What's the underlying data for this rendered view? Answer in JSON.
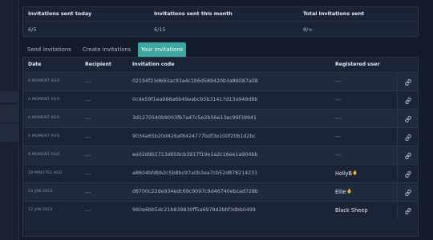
{
  "stats": [
    {
      "label": "Invitations sent today",
      "value": "6/5"
    },
    {
      "label": "Invitations sent this month",
      "value": "6/15"
    },
    {
      "label": "Total invitations sent",
      "value": "8/∞"
    }
  ],
  "tabs": [
    {
      "label": "Send invitations",
      "active": false
    },
    {
      "label": "Create invitations",
      "active": false
    },
    {
      "label": "Your invitations",
      "active": true
    }
  ],
  "table": {
    "headers": {
      "date": "Date",
      "recipient": "Recipient",
      "code": "Invitation code",
      "user": "Registered user"
    },
    "rows": [
      {
        "date": "A MOMENT AGO",
        "recipient": "---",
        "code": "02194f23d693ac93a4c1b6d589420b3a86087a08",
        "user": "---",
        "flame": false
      },
      {
        "date": "A MOMENT AGO",
        "recipient": "---",
        "code": "0cde59f1ea988a6b49eabcb5b31417d13a949d8b",
        "user": "---",
        "flame": false
      },
      {
        "date": "A MOMENT AGO",
        "recipient": "---",
        "code": "3d1270540b9003fb7a47c5e2b56e13ec99f39941",
        "user": "---",
        "flame": false
      },
      {
        "date": "A MOMENT AGO",
        "recipient": "---",
        "code": "9034a65b20d426af6424777bdf3e100f20b1d2bc",
        "user": "---",
        "flame": false
      },
      {
        "date": "A MOMENT AGO",
        "recipient": "---",
        "code": "ee02d9b1713d659cb3917f19e1a2c16ee1a904bb",
        "user": "---",
        "flame": false
      },
      {
        "date": "18 MINUTES AGO",
        "recipient": "---",
        "code": "a8604bfdbb2c5b8bc97a0b3ea7cb52d878214231",
        "user": "HollyB",
        "flame": true
      },
      {
        "date": "23 JAN 2023",
        "recipient": "---",
        "code": "d6700c22de934edc69c9097c9d46740ebcad728b",
        "user": "Ellie",
        "flame": true
      },
      {
        "date": "12 JAN 2023",
        "recipient": "---",
        "code": "960a6bb5dc21b839830ff5a6978d2bbf3dbb0499",
        "user": "Black Sheep",
        "flame": false
      }
    ]
  },
  "icons": {
    "row_action": "link-icon",
    "user_badge": "flame-icon"
  },
  "colors": {
    "accent": "#3aa8a0",
    "flame": "#e8b43a"
  }
}
